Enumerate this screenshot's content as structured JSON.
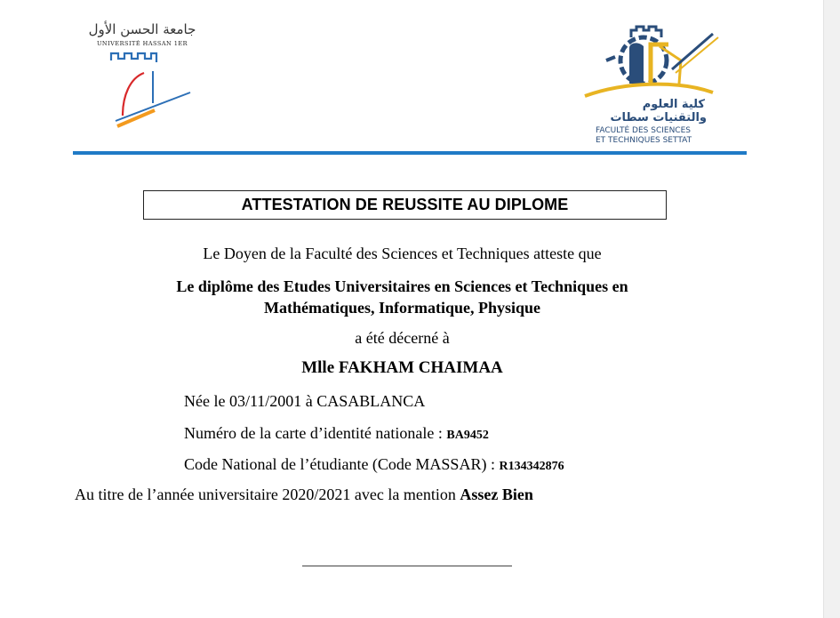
{
  "header": {
    "university_ar": "جامعة الحسن الأول",
    "university_fr": "UNIVERSITÉ HASSAN 1ER",
    "faculty_ar_line1": "كلية العلوم",
    "faculty_ar_line2": "والتقنيات سطات",
    "faculty_fr_line1": "FACULTÉ DES SCIENCES",
    "faculty_fr_line2": "ET TECHNIQUES SETTAT"
  },
  "document": {
    "title": "ATTESTATION DE REUSSITE AU DIPLOME",
    "intro": "Le Doyen de la Faculté des Sciences et Techniques  atteste que",
    "diploma_line1": "Le diplôme des Etudes Universitaires en Sciences et Techniques  en",
    "diploma_line2": "Mathématiques, Informatique, Physique",
    "awarded": "a été décerné à",
    "recipient": "Mlle FAKHAM CHAIMAA",
    "birth": "Née le 03/11/2001 à CASABLANCA",
    "cin_label": "Numéro de la carte d’identité nationale : ",
    "cin_value": "BA9452",
    "massar_label": "Code National de l’étudiante  (Code MASSAR) : ",
    "massar_value": "R134342876",
    "year_prefix": "Au titre de l’année universitaire 2020/2021 avec la mention ",
    "mention": "Assez Bien"
  },
  "colors": {
    "separator": "#1f7ac6",
    "fst_blue": "#2a4d7a",
    "fst_gold": "#e8b422",
    "uh1_blue": "#2c6fb6",
    "uh1_red": "#d8282a",
    "uh1_orange": "#f39a1e"
  }
}
